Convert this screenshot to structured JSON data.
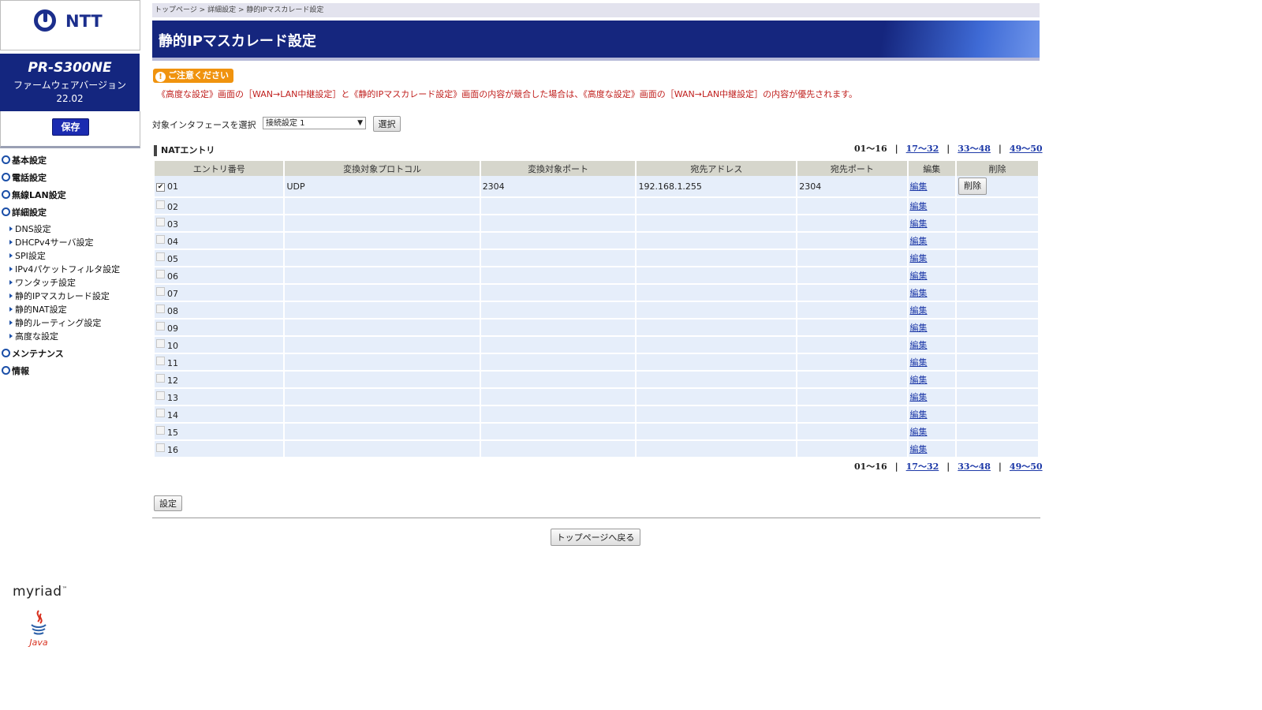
{
  "sidebar": {
    "brand": "NTT",
    "model": "PR-S300NE",
    "firmware_label": "ファームウェアバージョン",
    "firmware_version": "22.02",
    "save_label": "保存",
    "nav": [
      {
        "label": "基本設定"
      },
      {
        "label": "電話設定"
      },
      {
        "label": "無線LAN設定"
      },
      {
        "label": "詳細設定"
      }
    ],
    "subnav": [
      {
        "label": "DNS設定"
      },
      {
        "label": "DHCPv4サーバ設定"
      },
      {
        "label": "SPI設定"
      },
      {
        "label": "IPv4パケットフィルタ設定"
      },
      {
        "label": "ワンタッチ設定"
      },
      {
        "label": "静的IPマスカレード設定"
      },
      {
        "label": "静的NAT設定"
      },
      {
        "label": "静的ルーティング設定"
      },
      {
        "label": "高度な設定"
      }
    ],
    "nav_bottom": [
      {
        "label": "メンテナンス"
      },
      {
        "label": "情報"
      }
    ],
    "footer_logo": "myriad",
    "footer_logo_tm": "™",
    "java_label": "Java"
  },
  "breadcrumb": "トップページ > 詳細設定 > 静的IPマスカレード設定",
  "page_title": "静的IPマスカレード設定",
  "caution": {
    "badge": "ご注意ください",
    "text": "《高度な設定》画面の［WAN→LAN中継設定］と《静的IPマスカレード設定》画面の内容が競合した場合は、《高度な設定》画面の［WAN→LAN中継設定］の内容が優先されます。"
  },
  "interface": {
    "label": "対象インタフェースを選択",
    "selected": "接続設定 1",
    "select_button": "選択"
  },
  "section_title": "NATエントリ",
  "pager": {
    "current": "01〜16",
    "sep": "|",
    "links": [
      "17〜32",
      "33〜48",
      "49〜50"
    ]
  },
  "table": {
    "headers": [
      "エントリ番号",
      "変換対象プロトコル",
      "変換対象ポート",
      "宛先アドレス",
      "宛先ポート",
      "編集",
      "削除"
    ],
    "edit_label": "編集",
    "delete_label": "削除",
    "rows": [
      {
        "no": "01",
        "checked": true,
        "protocol": "UDP",
        "port": "2304",
        "dest_addr": "192.168.1.255",
        "dest_port": "2304"
      },
      {
        "no": "02",
        "checked": false,
        "protocol": "",
        "port": "",
        "dest_addr": "",
        "dest_port": ""
      },
      {
        "no": "03",
        "checked": false,
        "protocol": "",
        "port": "",
        "dest_addr": "",
        "dest_port": ""
      },
      {
        "no": "04",
        "checked": false,
        "protocol": "",
        "port": "",
        "dest_addr": "",
        "dest_port": ""
      },
      {
        "no": "05",
        "checked": false,
        "protocol": "",
        "port": "",
        "dest_addr": "",
        "dest_port": ""
      },
      {
        "no": "06",
        "checked": false,
        "protocol": "",
        "port": "",
        "dest_addr": "",
        "dest_port": ""
      },
      {
        "no": "07",
        "checked": false,
        "protocol": "",
        "port": "",
        "dest_addr": "",
        "dest_port": ""
      },
      {
        "no": "08",
        "checked": false,
        "protocol": "",
        "port": "",
        "dest_addr": "",
        "dest_port": ""
      },
      {
        "no": "09",
        "checked": false,
        "protocol": "",
        "port": "",
        "dest_addr": "",
        "dest_port": ""
      },
      {
        "no": "10",
        "checked": false,
        "protocol": "",
        "port": "",
        "dest_addr": "",
        "dest_port": ""
      },
      {
        "no": "11",
        "checked": false,
        "protocol": "",
        "port": "",
        "dest_addr": "",
        "dest_port": ""
      },
      {
        "no": "12",
        "checked": false,
        "protocol": "",
        "port": "",
        "dest_addr": "",
        "dest_port": ""
      },
      {
        "no": "13",
        "checked": false,
        "protocol": "",
        "port": "",
        "dest_addr": "",
        "dest_port": ""
      },
      {
        "no": "14",
        "checked": false,
        "protocol": "",
        "port": "",
        "dest_addr": "",
        "dest_port": ""
      },
      {
        "no": "15",
        "checked": false,
        "protocol": "",
        "port": "",
        "dest_addr": "",
        "dest_port": ""
      },
      {
        "no": "16",
        "checked": false,
        "protocol": "",
        "port": "",
        "dest_addr": "",
        "dest_port": ""
      }
    ]
  },
  "set_button": "設定",
  "back_button": "トップページへ戻る",
  "colors": {
    "header_navy": "#14267f",
    "caution_orange": "#f0930e",
    "caution_text": "#c0201e",
    "row_bg": "#e6eefa",
    "header_bg": "#d6d6cc",
    "link": "#1e3aa8"
  }
}
